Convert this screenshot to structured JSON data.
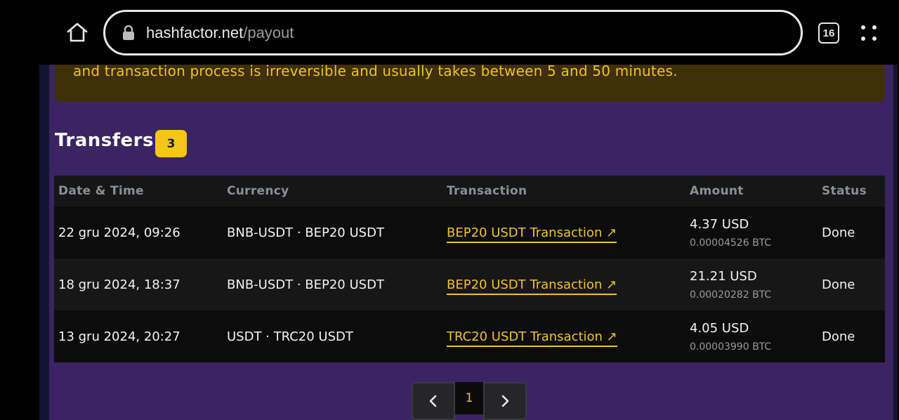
{
  "browser": {
    "url_host": "hashfactor.net",
    "url_path": "/payout",
    "tab_count": "16"
  },
  "notice": {
    "text": "and transaction process is irreversible and usually takes between 5 and 50 minutes."
  },
  "transfers": {
    "title": "Transfers",
    "count": "3",
    "columns": {
      "date": "Date & Time",
      "currency": "Currency",
      "transaction": "Transaction",
      "amount": "Amount",
      "status": "Status"
    },
    "rows": [
      {
        "date": "22 gru 2024, 09:26",
        "currency": "BNB-USDT · BEP20 USDT",
        "transaction": "BEP20 USDT Transaction ↗",
        "amount_usd": "4.37 USD",
        "amount_btc": "0.00004526 BTC",
        "status": "Done"
      },
      {
        "date": "18 gru 2024, 18:37",
        "currency": "BNB-USDT · BEP20 USDT",
        "transaction": "BEP20 USDT Transaction ↗",
        "amount_usd": "21.21 USD",
        "amount_btc": "0.00020282 BTC",
        "status": "Done"
      },
      {
        "date": "13 gru 2024, 20:27",
        "currency": "USDT · TRC20 USDT",
        "transaction": "TRC20 USDT Transaction ↗",
        "amount_usd": "4.05 USD",
        "amount_btc": "0.00003990 BTC",
        "status": "Done"
      }
    ]
  },
  "pagination": {
    "current_page": "1"
  },
  "colors": {
    "accent": "#f0c419",
    "panel": "#3a2463",
    "notice_bg": "#3e3008"
  },
  "icons": {
    "home": "home-icon",
    "lock": "lock-icon",
    "menu": "kebab-menu-icon",
    "prev": "chevron-left-icon",
    "next": "chevron-right-icon"
  }
}
